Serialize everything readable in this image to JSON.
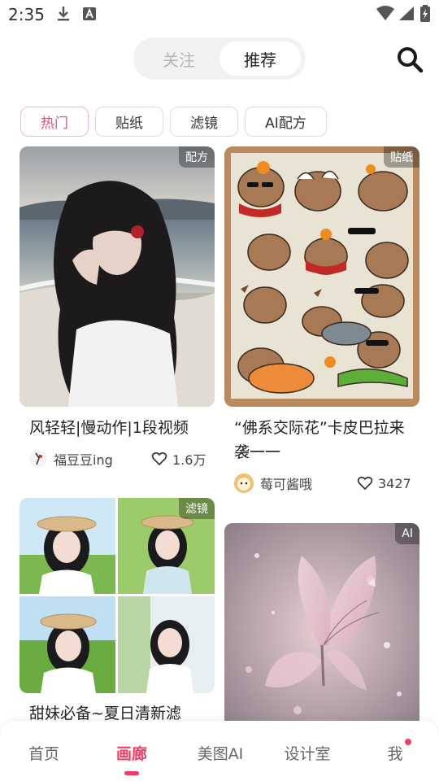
{
  "status_bar": {
    "time": "2:35"
  },
  "header": {
    "tabs": [
      {
        "label": "关注",
        "active": false
      },
      {
        "label": "推荐",
        "active": true
      }
    ]
  },
  "filters": [
    {
      "label": "热门",
      "active": true
    },
    {
      "label": "贴纸",
      "active": false
    },
    {
      "label": "滤镜",
      "active": false
    },
    {
      "label": "AI配方",
      "active": false
    }
  ],
  "feed": [
    {
      "tag": "配方",
      "title": "风轻轻|慢动作|1段视频",
      "author": "福豆豆ing",
      "likes": "1.6万"
    },
    {
      "tag": "贴纸",
      "title_line1": "“佛系交际花”卡皮巴拉来",
      "title_line2": "袭一一",
      "author": "莓可酱哦",
      "likes": "3427"
    },
    {
      "tag": "滤镜",
      "title": "甜妹必备~夏日清新滤"
    },
    {
      "tag": "AI"
    }
  ],
  "bottom_nav": {
    "items": [
      {
        "label": "首页",
        "active": false
      },
      {
        "label": "画廊",
        "active": true
      },
      {
        "label": "美图AI",
        "active": false
      },
      {
        "label": "设计室",
        "active": false
      },
      {
        "label": "我",
        "active": false,
        "badge": true
      }
    ]
  },
  "colors": {
    "accent": "#f03c64",
    "chip_active_border": "#f6b7c7"
  }
}
